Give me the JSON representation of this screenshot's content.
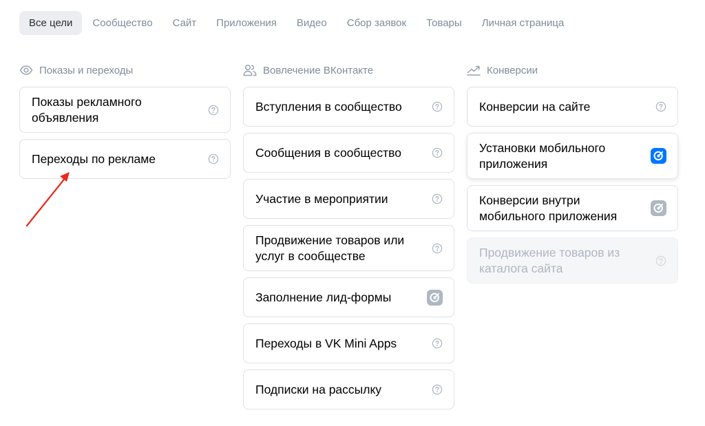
{
  "tabs": [
    {
      "label": "Все цели",
      "active": true
    },
    {
      "label": "Сообщество"
    },
    {
      "label": "Сайт"
    },
    {
      "label": "Приложения"
    },
    {
      "label": "Видео"
    },
    {
      "label": "Сбор заявок"
    },
    {
      "label": "Товары"
    },
    {
      "label": "Личная страница"
    }
  ],
  "columns": {
    "views": {
      "title": "Показы и переходы",
      "icon": "eye-icon",
      "items": [
        {
          "label": "Показы рекламного объявления",
          "icon": "help-icon"
        },
        {
          "label": "Переходы по рекламе",
          "icon": "help-icon"
        }
      ]
    },
    "engagement": {
      "title": "Вовлечение ВКонтакте",
      "icon": "users-icon",
      "items": [
        {
          "label": "Вступления в сообщество",
          "icon": "help-icon"
        },
        {
          "label": "Сообщения в сообщество",
          "icon": "help-icon"
        },
        {
          "label": "Участие в мероприятии",
          "icon": "help-icon"
        },
        {
          "label": "Продвижение товаров или услуг в сообществе",
          "icon": "help-icon"
        },
        {
          "label": "Заполнение лид-формы",
          "icon": "target-app-icon-gray"
        },
        {
          "label": "Переходы в VK Mini Apps",
          "icon": "help-icon"
        },
        {
          "label": "Подписки на рассылку",
          "icon": "help-icon"
        }
      ]
    },
    "conversions": {
      "title": "Конверсии",
      "icon": "trend-icon",
      "items": [
        {
          "label": "Конверсии на сайте",
          "icon": "help-icon"
        },
        {
          "label": "Установки мобильного приложения",
          "icon": "target-app-icon-blue"
        },
        {
          "label": "Конверсии внутри мобильного приложения",
          "icon": "target-app-icon-gray"
        },
        {
          "label": "Продвижение товаров из каталога сайта",
          "icon": "help-icon",
          "disabled": true
        }
      ]
    }
  },
  "colors": {
    "accent": "#0077ff",
    "muted": "#818c99",
    "border": "#dce1e6",
    "annotation_arrow": "#e8291c"
  }
}
